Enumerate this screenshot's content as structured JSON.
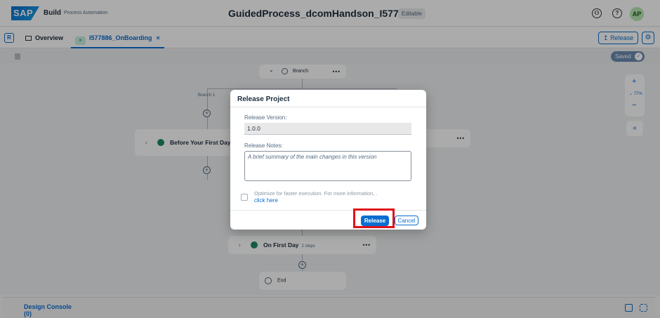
{
  "shell": {
    "logo": "SAP",
    "brand": "Build",
    "brand_sub": "Process Automation",
    "title": "GuidedProcess_dcomHandson_I577886",
    "badge": "Editable",
    "avatar_initials": "AP",
    "icons": [
      "connection-icon",
      "help-icon"
    ]
  },
  "tabs": {
    "overview_label": "Overview",
    "active_label": "I577886_OnBoarding",
    "active_close": "×",
    "release_label": "Release",
    "release_icon": "↥",
    "settings_icon": "⚙"
  },
  "canvas": {
    "saved_label": "Saved",
    "saved_check": "✓",
    "branch_node_label": "Branch",
    "branch_label": "Branch 1",
    "before_label": "Before Your First Day",
    "on_first_day_label": "On First Day",
    "on_first_day_sub": "2 steps",
    "end_label": "End",
    "zoom_plus": "+",
    "zoom_level": "⌄ 77%",
    "zoom_minus": "−",
    "collapse_icon": "«",
    "dots": "•••"
  },
  "dialog": {
    "title": "Release Project",
    "version_label": "Release Version:",
    "version_value": "1.0.0",
    "notes_label": "Release Notes:",
    "notes_placeholder": "A brief summary of the main changes in this version",
    "optimize_text": "Optimize for faster execution. For more information, .",
    "optimize_link": "click here",
    "release_button": "Release",
    "cancel_button": "Cancel"
  },
  "console": {
    "tab_label": "Design Console (0)"
  },
  "colors": {
    "accent": "#0a6ed1",
    "highlight": "#e0101a",
    "step_green": "#1d8a65"
  }
}
